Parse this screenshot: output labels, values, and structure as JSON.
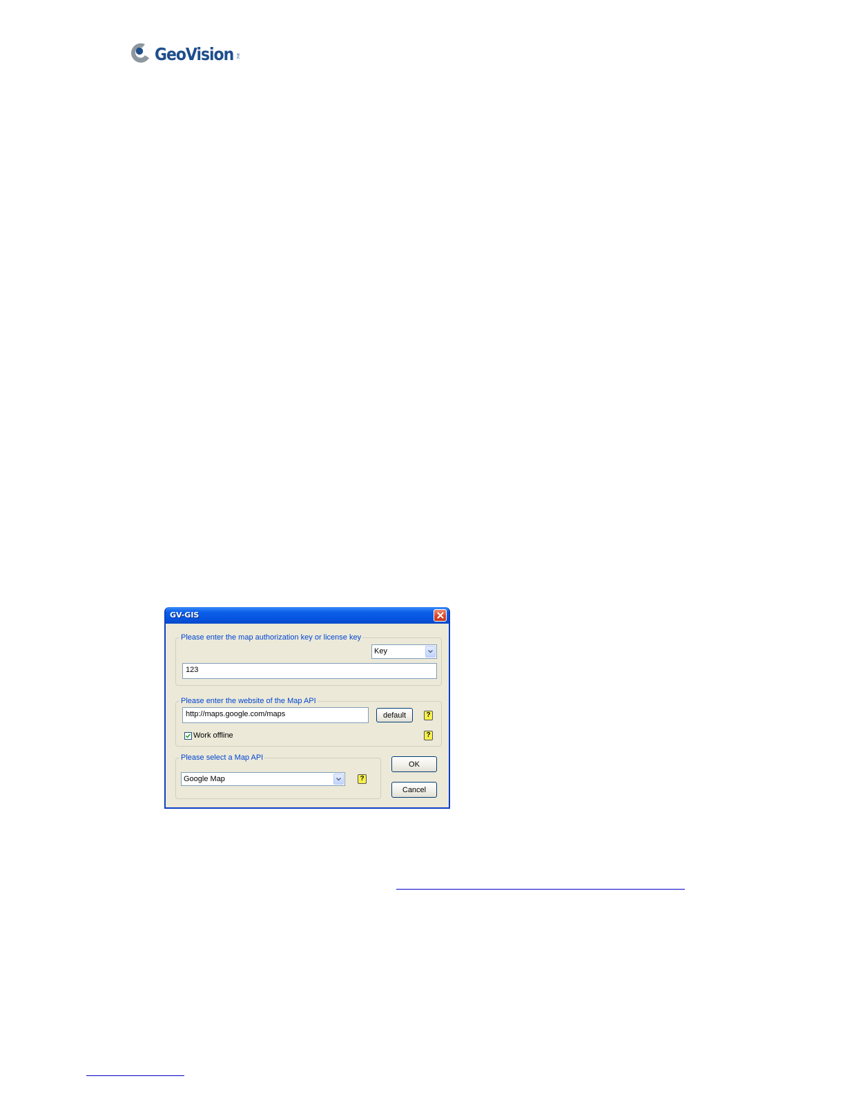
{
  "logo": {
    "name": "GeoVision",
    "suffix": "Inc",
    "brand_color": "#1f4e8c"
  },
  "dialog": {
    "title": "GV-GIS",
    "close_icon": "close-icon",
    "key_group": {
      "legend": "Please enter the map authorization key or license key",
      "key_type": {
        "selected": "Key"
      },
      "key_value": "123"
    },
    "website_group": {
      "legend": "Please enter the website of the Map API",
      "url_value": "http://maps.google.com/maps",
      "default_label": "default",
      "work_offline_label": "Work offline",
      "work_offline_checked": true,
      "help_icon": "help-icon"
    },
    "api_group": {
      "legend": "Please select a Map API",
      "selected_api": "Google Map"
    },
    "ok_label": "OK",
    "cancel_label": "Cancel"
  },
  "colors": {
    "titlebar": "#0554e0",
    "legend_text": "#0046d5",
    "dialog_bg": "#ece9d8",
    "help_icon_bg": "#f7f04a"
  }
}
